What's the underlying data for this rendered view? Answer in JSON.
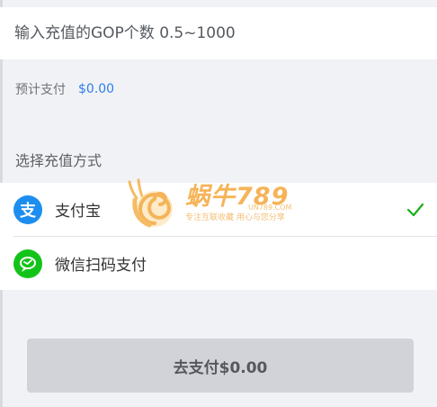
{
  "recharge": {
    "amount_placeholder": "输入充值的GOP个数 0.5~1000",
    "estimate_label": "预计支付",
    "estimate_value": "$0.00"
  },
  "payment_methods": {
    "section_title": "选择充值方式",
    "items": [
      {
        "label": "支付宝",
        "icon": "alipay-icon",
        "icon_glyph": "支",
        "selected": true
      },
      {
        "label": "微信扫码支付",
        "icon": "wechat-icon",
        "selected": false
      }
    ]
  },
  "pay_button": {
    "label": "去支付$0.00"
  },
  "watermark": {
    "title": "蜗牛789",
    "url": "UN789.COM",
    "subtitle": "专注互联收藏    用心与您分享"
  },
  "colors": {
    "accent_blue": "#2f7fe6",
    "alipay_blue": "#1d8ef0",
    "wechat_green": "#14c31a",
    "check_green": "#1aad19",
    "button_disabled": "#d1d3d9"
  }
}
